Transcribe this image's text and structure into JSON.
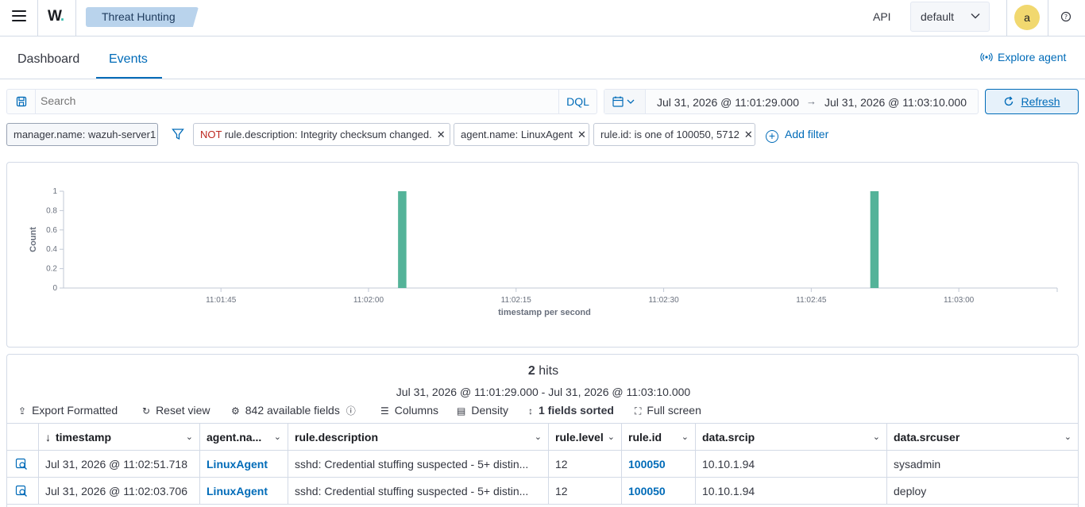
{
  "header": {
    "logo": "W",
    "breadcrumb": "Threat Hunting",
    "api_label": "API",
    "api_selected": "default",
    "user_initial": "a"
  },
  "tabs": [
    {
      "label": "Dashboard",
      "active": false
    },
    {
      "label": "Events",
      "active": true
    }
  ],
  "explore_agent": "Explore agent",
  "search": {
    "placeholder": "Search",
    "language": "DQL"
  },
  "date_range": {
    "start": "Jul 31, 2026 @ 11:01:29.000",
    "arrow": "→",
    "end": "Jul 31, 2026 @ 11:03:10.000"
  },
  "refresh_label": "Refresh",
  "filters": [
    {
      "text": "manager.name: wazuh-server1",
      "negated": false,
      "removable": false
    },
    {
      "prefix": "NOT",
      "text": "rule.description: Integrity checksum changed.",
      "negated": true,
      "removable": true
    },
    {
      "text": "agent.name: LinuxAgent",
      "negated": false,
      "removable": true
    },
    {
      "text": "rule.id: is one of 100050, 5712",
      "negated": false,
      "removable": true
    }
  ],
  "add_filter": "Add filter",
  "chart_data": {
    "type": "bar",
    "xlabel": "timestamp per second",
    "ylabel": "Count",
    "ylim": [
      0,
      1
    ],
    "y_ticks": [
      "0",
      "0.2",
      "0.4",
      "0.6",
      "0.8",
      "1"
    ],
    "x_ticks": [
      "11:01:45",
      "11:02:00",
      "11:02:15",
      "11:02:30",
      "11:02:45",
      "11:03:00"
    ],
    "bars": [
      {
        "x": "11:02:03",
        "value": 1
      },
      {
        "x": "11:02:51",
        "value": 1
      }
    ],
    "color": "#54b399"
  },
  "results": {
    "hits_count": "2",
    "hits_label": "hits",
    "range": "Jul 31, 2026 @ 11:01:29.000 - Jul 31, 2026 @ 11:03:10.000",
    "toolbar": {
      "export": "Export Formatted",
      "reset": "Reset view",
      "fields": "842 available fields",
      "columns": "Columns",
      "density": "Density",
      "sorted": "1 fields sorted",
      "fullscreen": "Full screen"
    },
    "columns": [
      "timestamp",
      "agent.na...",
      "rule.description",
      "rule.level",
      "rule.id",
      "data.srcip",
      "data.srcuser"
    ],
    "rows": [
      [
        "Jul 31, 2026 @ 11:02:51.718",
        "LinuxAgent",
        "sshd: Credential stuffing suspected - 5+ distin...",
        "12",
        "100050",
        "10.10.1.94",
        "sysadmin"
      ],
      [
        "Jul 31, 2026 @ 11:02:03.706",
        "LinuxAgent",
        "sshd: Credential stuffing suspected - 5+ distin...",
        "12",
        "100050",
        "10.10.1.94",
        "deploy"
      ]
    ]
  }
}
